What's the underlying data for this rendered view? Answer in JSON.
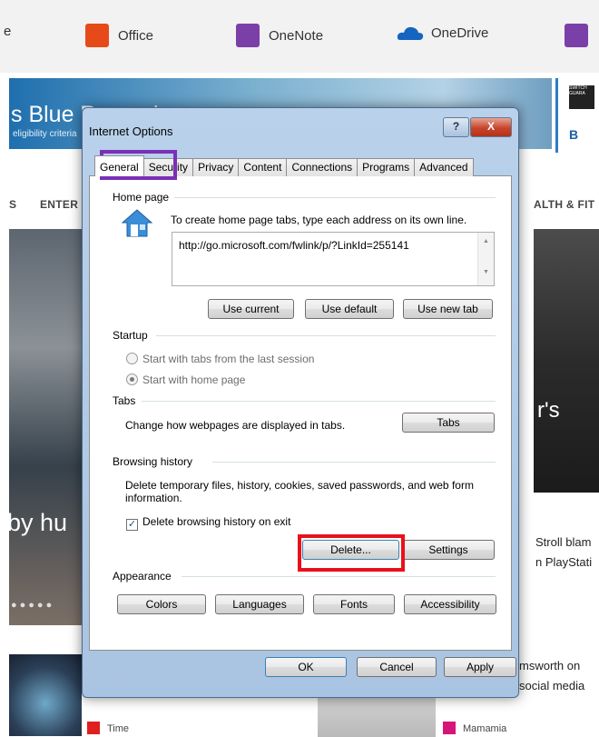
{
  "background": {
    "topbar_apps": [
      {
        "label": "e",
        "icon": "edge-icon",
        "color": "#1e7ac8"
      },
      {
        "label": "Office",
        "icon": "office-icon",
        "color": "#e64a19"
      },
      {
        "label": "OneNote",
        "icon": "onenote-icon",
        "color": "#7b3fa8"
      },
      {
        "label": "OneDrive",
        "icon": "onedrive-icon",
        "color": "#1565c0"
      },
      {
        "label": "",
        "icon": "store-icon",
        "color": "#7b3fa8"
      }
    ],
    "banner_text": "s Blue Rewards",
    "banner_sub": "eligibility criteria",
    "nav_left": "S",
    "nav_enter": "ENTER",
    "nav_right": "ALTH & FIT",
    "right_ad_text": "SWITCH GUARA",
    "right_ad_b": "B",
    "right_side_s": "r's",
    "left_text": "by hu",
    "right_blurb": "Stroll blam n PlayStati",
    "bottom_right_text": "msworth on social media",
    "bottom_source_left": "Time",
    "bottom_source_mid": "Mamamia"
  },
  "dialog": {
    "title": "Internet Options",
    "help_label": "?",
    "close_label": "X",
    "tabs": [
      "General",
      "Security",
      "Privacy",
      "Content",
      "Connections",
      "Programs",
      "Advanced"
    ],
    "active_tab": "General",
    "home_page": {
      "label": "Home page",
      "instruction": "To create home page tabs, type each address on its own line.",
      "url": "http://go.microsoft.com/fwlink/p/?LinkId=255141",
      "buttons": [
        "Use current",
        "Use default",
        "Use new tab"
      ]
    },
    "startup": {
      "label": "Startup",
      "options": [
        "Start with tabs from the last session",
        "Start with home page"
      ],
      "selected": "Start with home page"
    },
    "tabs_group": {
      "label": "Tabs",
      "text": "Change how webpages are displayed in tabs.",
      "button": "Tabs"
    },
    "browsing_history": {
      "label": "Browsing history",
      "text": "Delete temporary files, history, cookies, saved passwords, and web form information.",
      "checkbox_label": "Delete browsing history on exit",
      "checked": true,
      "delete_button": "Delete...",
      "settings_button": "Settings"
    },
    "appearance": {
      "label": "Appearance",
      "buttons": [
        "Colors",
        "Languages",
        "Fonts",
        "Accessibility"
      ]
    },
    "footer": {
      "ok": "OK",
      "cancel": "Cancel",
      "apply": "Apply"
    }
  }
}
